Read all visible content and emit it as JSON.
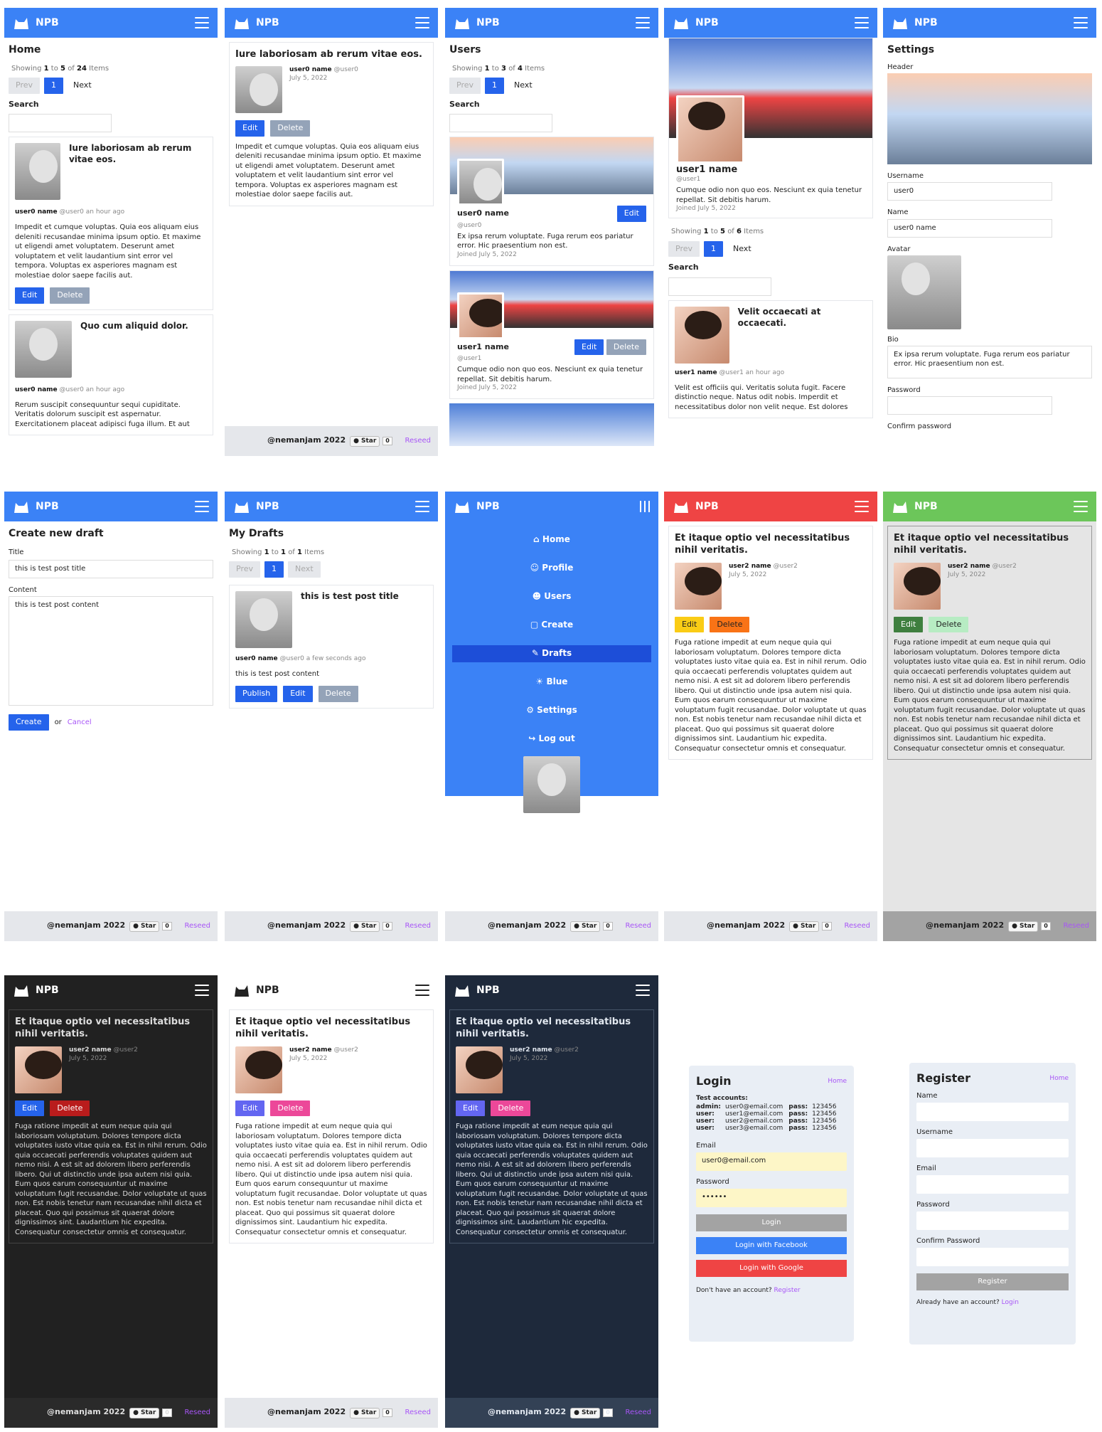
{
  "app": {
    "name": "NPB",
    "footer": "@nemanjam 2022",
    "star": "Star",
    "star_count": "0",
    "reseed": "Reseed"
  },
  "pagination": {
    "showing": "Showing",
    "to": "to",
    "of": "of",
    "items": "Items",
    "prev": "Prev",
    "page": "1",
    "next": "Next"
  },
  "home": {
    "title": "Home",
    "from": "1",
    "to_n": "5",
    "total": "24",
    "search": "Search",
    "posts": [
      {
        "title": "Iure laboriosam ab rerum vitae eos.",
        "user": "user0 name",
        "handle": "@user0",
        "time": "an hour ago",
        "body": "Impedit et cumque voluptas. Quia eos aliquam eius deleniti recusandae minima ipsum optio. Et maxime ut eligendi amet voluptatem. Deserunt amet voluptatem et velit laudantium sint error vel tempora. Voluptas ex asperiores magnam est molestiae dolor saepe facilis aut."
      },
      {
        "title": "Quo cum aliquid dolor.",
        "user": "user0 name",
        "handle": "@user0",
        "time": "an hour ago",
        "body": "Rerum suscipit consequuntur sequi cupiditate. Veritatis dolorum suscipit est aspernatur. Exercitationem placeat adipisci fuga illum. Et aut"
      }
    ]
  },
  "edit": "Edit",
  "delete": "Delete",
  "post": {
    "title": "Iure laboriosam ab rerum vitae eos.",
    "user": "user0 name",
    "handle": "@user0",
    "date": "July 5, 2022",
    "body": "Impedit et cumque voluptas. Quia eos aliquam eius deleniti recusandae minima ipsum optio. Et maxime ut eligendi amet voluptatem. Deserunt amet voluptatem et velit laudantium sint error vel tempora. Voluptas ex asperiores magnam est molestiae dolor saepe facilis aut."
  },
  "users": {
    "title": "Users",
    "from": "1",
    "to_n": "3",
    "total": "4",
    "list": [
      {
        "name": "user0 name",
        "handle": "@user0",
        "bio": "Ex ipsa rerum voluptate. Fuga rerum eos pariatur error. Hic praesentium non est.",
        "joined": "Joined July 5, 2022"
      },
      {
        "name": "user1 name",
        "handle": "@user1",
        "bio": "Cumque odio non quo eos. Nesciunt ex quia tenetur repellat. Sit debitis harum.",
        "joined": "Joined July 5, 2022"
      }
    ]
  },
  "profile": {
    "name": "user1 name",
    "handle": "@user1",
    "bio": "Cumque odio non quo eos. Nesciunt ex quia tenetur repellat. Sit debitis harum.",
    "joined": "Joined July 5, 2022",
    "from": "1",
    "to_n": "5",
    "total": "6",
    "post_title": "Velit occaecati at occaecati.",
    "time": "an hour ago",
    "post_body": "Velit est officiis qui. Veritatis soluta fugit. Facere distinctio neque. Natus odit nobis. Imperdit et necessitatibus dolor non velit neque. Est dolores"
  },
  "settings": {
    "title": "Settings",
    "header": "Header",
    "username_l": "Username",
    "username": "user0",
    "name_l": "Name",
    "name": "user0 name",
    "avatar": "Avatar",
    "bio_l": "Bio",
    "bio": "Ex ipsa rerum voluptate. Fuga rerum eos pariatur error. Hic praesentium non est.",
    "password": "Password",
    "confirm": "Confirm password"
  },
  "create": {
    "title": "Create new draft",
    "title_l": "Title",
    "title_v": "this is test post title",
    "content_l": "Content",
    "content_v": "this is test post content",
    "create": "Create",
    "or": "or",
    "cancel": "Cancel"
  },
  "drafts": {
    "title": "My Drafts",
    "from": "1",
    "to_n": "1",
    "total": "1",
    "post_title": "this is test post title",
    "time": "a few seconds ago",
    "body": "this is test post content",
    "publish": "Publish"
  },
  "menu": [
    "Home",
    "Profile",
    "Users",
    "Create",
    "Drafts",
    "Blue",
    "Settings",
    "Log out"
  ],
  "theme_post": {
    "title": "Et itaque optio vel necessitatibus nihil veritatis.",
    "user": "user2 name",
    "handle": "@user2",
    "date": "July 5, 2022",
    "body": "Fuga ratione impedit at eum neque quia qui laboriosam voluptatum. Dolores tempore dicta voluptates iusto vitae quia ea. Est in nihil rerum. Odio quia occaecati perferendis voluptates quidem aut nemo nisi. A est sit ad dolorem libero perferendis libero. Qui ut distinctio unde ipsa autem nisi quia. Eum quos earum consequuntur ut maxime voluptatum fugit recusandae. Dolor voluptate ut quas non. Est nobis tenetur nam recusandae nihil dicta et placeat. Quo qui possimus sit quaerat dolore dignissimos sint. Laudantium hic expedita. Consequatur consectetur omnis et consequatur."
  },
  "login": {
    "title": "Login",
    "home": "Home",
    "test": "Test accounts:",
    "accounts": [
      [
        "admin:",
        "user0@email.com",
        "pass:",
        "123456"
      ],
      [
        "user:",
        "user1@email.com",
        "pass:",
        "123456"
      ],
      [
        "user:",
        "user2@email.com",
        "pass:",
        "123456"
      ],
      [
        "user:",
        "user3@email.com",
        "pass:",
        "123456"
      ]
    ],
    "email_l": "Email",
    "email": "user0@email.com",
    "password_l": "Password",
    "password": "••••••",
    "login": "Login",
    "fb": "Login with Facebook",
    "google": "Login with Google",
    "no_acc": "Don't have an account?",
    "register": "Register"
  },
  "register": {
    "title": "Register",
    "home": "Home",
    "name": "Name",
    "username": "Username",
    "email": "Email",
    "password": "Password",
    "confirm": "Confirm Password",
    "btn": "Register",
    "have": "Already have an account?",
    "login": "Login"
  }
}
